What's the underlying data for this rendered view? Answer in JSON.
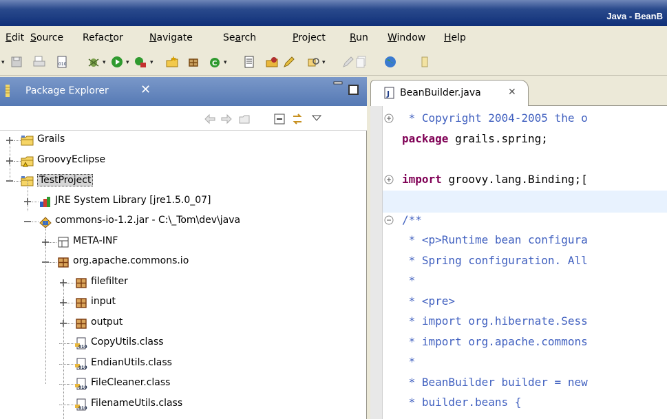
{
  "window": {
    "title": "Java - BeanB"
  },
  "menu": [
    {
      "label": "Edit",
      "u": "E",
      "rest": "dit"
    },
    {
      "label": "Source",
      "u": "S",
      "rest": "ource"
    },
    {
      "label": "Refactor",
      "pre": "Refac",
      "u": "t",
      "rest": "or"
    },
    {
      "label": "Navigate",
      "u": "N",
      "rest": "avigate"
    },
    {
      "label": "Search",
      "pre": "Se",
      "u": "a",
      "rest": "rch"
    },
    {
      "label": "Project",
      "u": "P",
      "rest": "roject"
    },
    {
      "label": "Run",
      "u": "R",
      "rest": "un"
    },
    {
      "label": "Window",
      "u": "W",
      "rest": "indow"
    },
    {
      "label": "Help",
      "u": "H",
      "rest": "elp"
    }
  ],
  "package_explorer": {
    "title": "Package Explorer",
    "tree": [
      {
        "label": "Grails",
        "icon": "project-folder-icon",
        "expander": "plus"
      },
      {
        "label": "GroovyEclipse",
        "icon": "project-folder-warning-icon",
        "expander": "plus"
      },
      {
        "label": "TestProject",
        "icon": "project-folder-icon",
        "expander": "minus",
        "selected": true
      },
      {
        "label": "JRE System Library [jre1.5.0_07]",
        "icon": "library-icon",
        "expander": "plus"
      },
      {
        "label": "commons-io-1.2.jar - C:\\_Tom\\dev\\java",
        "icon": "jar-icon",
        "expander": "minus"
      },
      {
        "label": "META-INF",
        "icon": "folder-icon",
        "expander": "plus"
      },
      {
        "label": "org.apache.commons.io",
        "icon": "package-icon",
        "expander": "minus"
      },
      {
        "label": "filefilter",
        "icon": "package-icon",
        "expander": "plus"
      },
      {
        "label": "input",
        "icon": "package-icon",
        "expander": "plus"
      },
      {
        "label": "output",
        "icon": "package-icon",
        "expander": "plus"
      },
      {
        "label": "CopyUtils.class",
        "icon": "class-file-icon",
        "expander": "none"
      },
      {
        "label": "EndianUtils.class",
        "icon": "class-file-icon",
        "expander": "none"
      },
      {
        "label": "FileCleaner.class",
        "icon": "class-file-icon",
        "expander": "none"
      },
      {
        "label": "FilenameUtils.class",
        "icon": "class-file-icon",
        "expander": "none"
      }
    ]
  },
  "editor": {
    "tab_title": "BeanBuilder.java",
    "lines": [
      {
        "parts": [
          {
            "t": " * Copyright 2004-2005 the o",
            "c": "cmt"
          }
        ],
        "fold": "plus"
      },
      {
        "parts": [
          {
            "t": "package ",
            "c": "kw"
          },
          {
            "t": "grails.spring;",
            "c": ""
          }
        ],
        "fold": ""
      },
      {
        "parts": [
          {
            "t": "",
            "c": ""
          }
        ],
        "fold": ""
      },
      {
        "parts": [
          {
            "t": "import ",
            "c": "kw"
          },
          {
            "t": "groovy.lang.Binding;[",
            "c": ""
          }
        ],
        "fold": "plus"
      },
      {
        "parts": [
          {
            "t": "",
            "c": ""
          }
        ],
        "fold": ""
      },
      {
        "parts": [
          {
            "t": "/**",
            "c": "cmt"
          }
        ],
        "fold": "minus"
      },
      {
        "parts": [
          {
            "t": " * <p>Runtime bean configura",
            "c": "cmt"
          }
        ],
        "fold": ""
      },
      {
        "parts": [
          {
            "t": " * Spring configuration. All",
            "c": "cmt"
          }
        ],
        "fold": ""
      },
      {
        "parts": [
          {
            "t": " *",
            "c": "cmt"
          }
        ],
        "fold": ""
      },
      {
        "parts": [
          {
            "t": " * <pre>",
            "c": "cmt"
          }
        ],
        "fold": ""
      },
      {
        "parts": [
          {
            "t": " * import org.hibernate.Sess",
            "c": "cmt"
          }
        ],
        "fold": ""
      },
      {
        "parts": [
          {
            "t": " * import org.apache.commons",
            "c": "cmt"
          }
        ],
        "fold": ""
      },
      {
        "parts": [
          {
            "t": " *",
            "c": "cmt"
          }
        ],
        "fold": ""
      },
      {
        "parts": [
          {
            "t": " * BeanBuilder builder = new",
            "c": "cmt"
          }
        ],
        "fold": ""
      },
      {
        "parts": [
          {
            "t": " * builder.beans {",
            "c": "cmt"
          }
        ],
        "fold": ""
      }
    ]
  }
}
